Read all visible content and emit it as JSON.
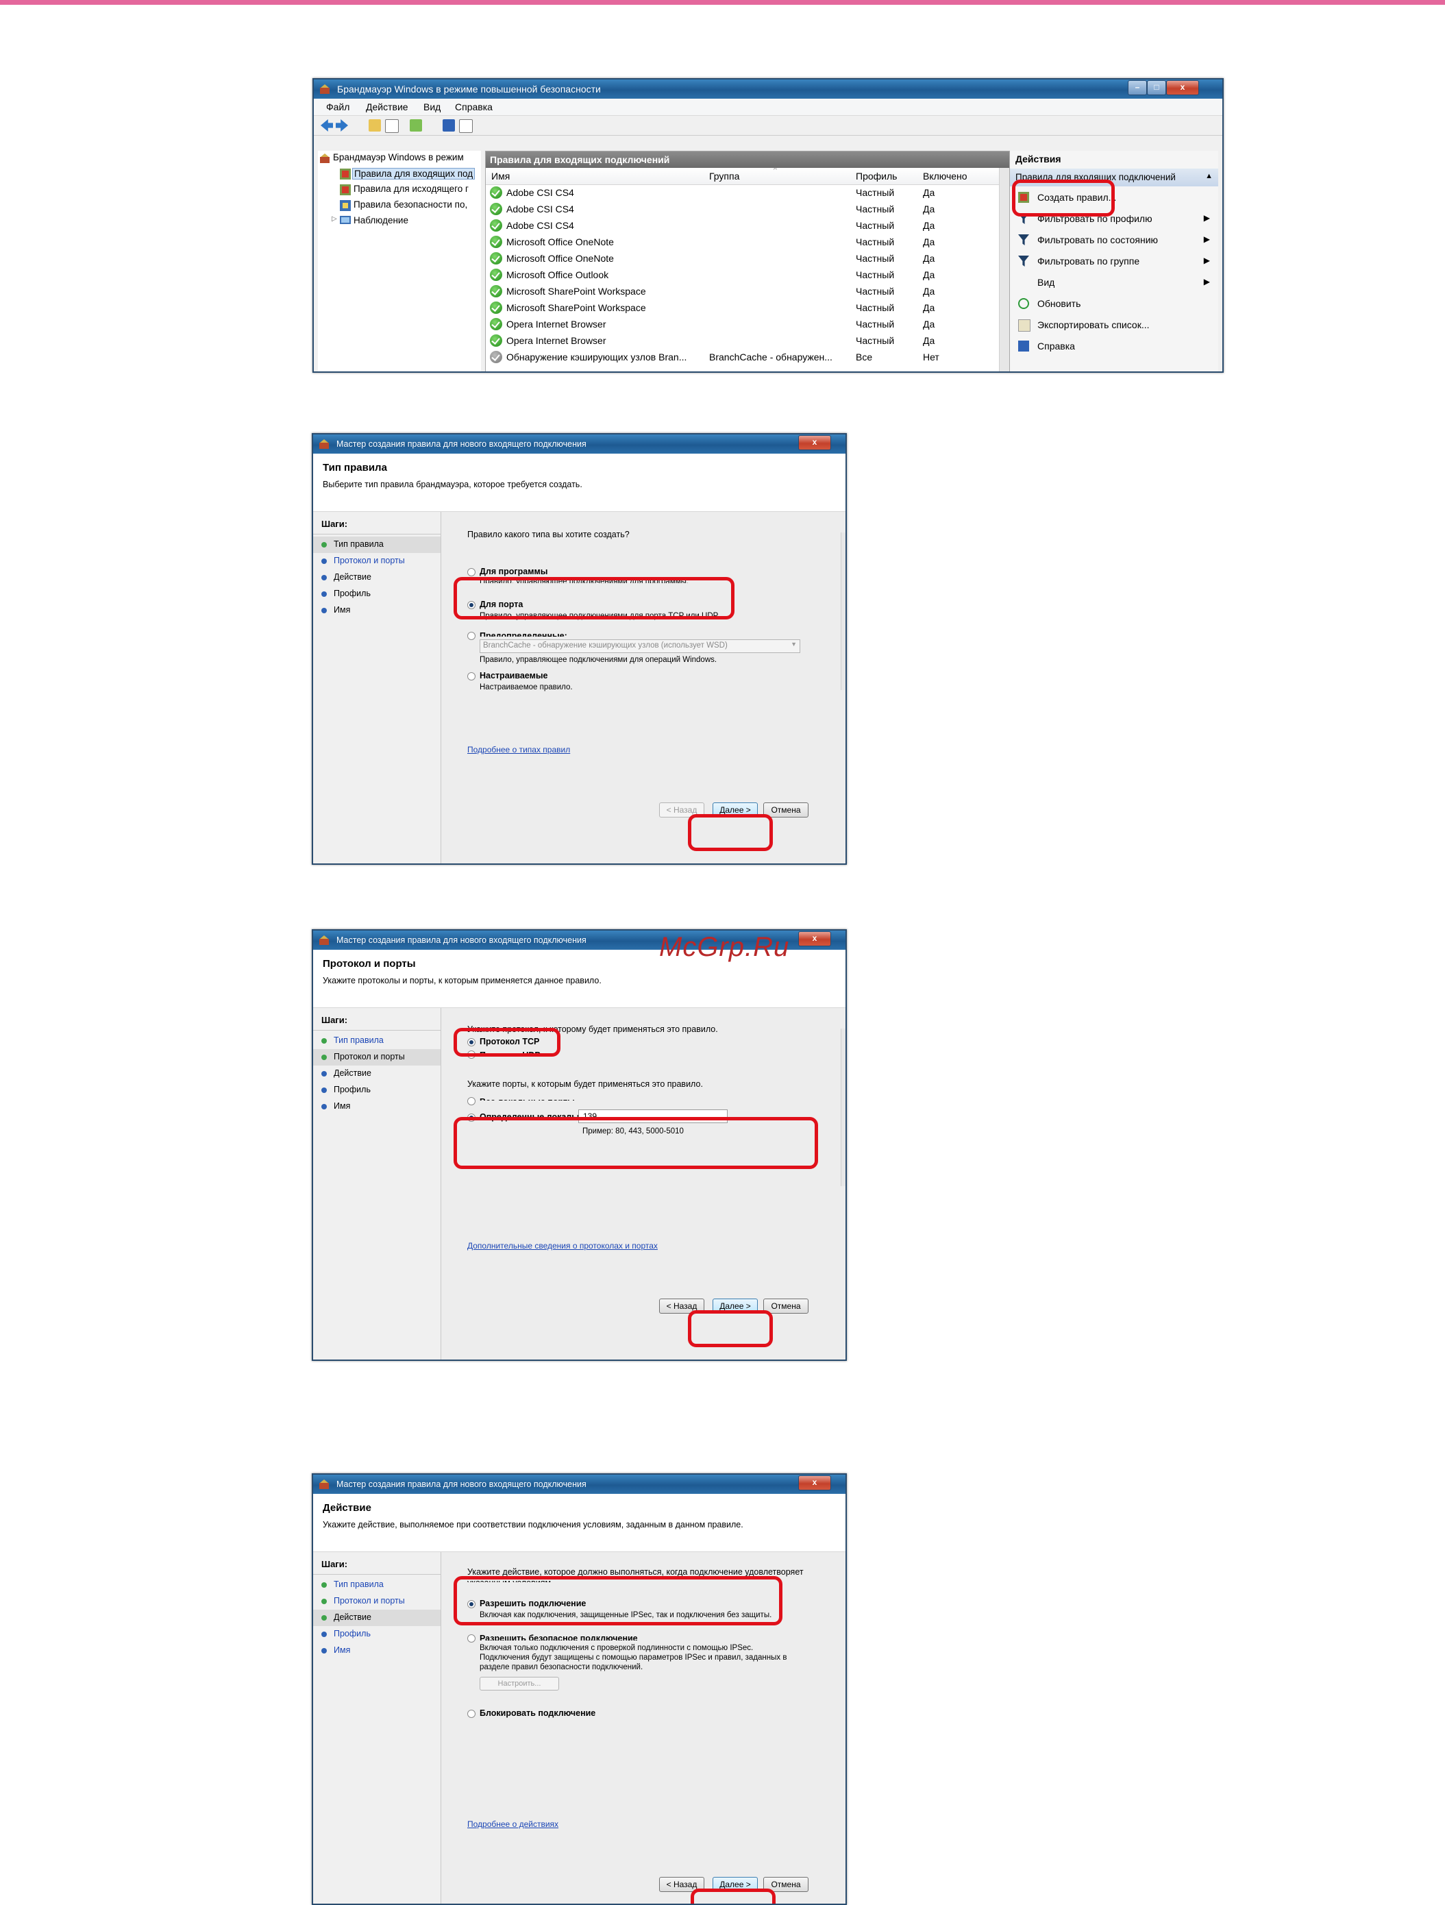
{
  "watermark": "McGrp.Ru",
  "main_window": {
    "title": "Брандмауэр Windows в режиме повышенной безопасности",
    "menu": [
      "Файл",
      "Действие",
      "Вид",
      "Справка"
    ],
    "tree": {
      "root": "Брандмауэр Windows в режим",
      "items": [
        "Правила для входящих под",
        "Правила для исходящего г",
        "Правила безопасности по,",
        "Наблюдение"
      ]
    },
    "rules_pane": {
      "title": "Правила для входящих подключений",
      "columns": [
        "Имя",
        "Группа",
        "Профиль",
        "Включено"
      ],
      "rows": [
        {
          "name": "Adobe CSI CS4",
          "group": "",
          "profile": "Частный",
          "enabled": "Да"
        },
        {
          "name": "Adobe CSI CS4",
          "group": "",
          "profile": "Частный",
          "enabled": "Да"
        },
        {
          "name": "Adobe CSI CS4",
          "group": "",
          "profile": "Частный",
          "enabled": "Да"
        },
        {
          "name": "Microsoft Office OneNote",
          "group": "",
          "profile": "Частный",
          "enabled": "Да"
        },
        {
          "name": "Microsoft Office OneNote",
          "group": "",
          "profile": "Частный",
          "enabled": "Да"
        },
        {
          "name": "Microsoft Office Outlook",
          "group": "",
          "profile": "Частный",
          "enabled": "Да"
        },
        {
          "name": "Microsoft SharePoint Workspace",
          "group": "",
          "profile": "Частный",
          "enabled": "Да"
        },
        {
          "name": "Microsoft SharePoint Workspace",
          "group": "",
          "profile": "Частный",
          "enabled": "Да"
        },
        {
          "name": "Opera Internet Browser",
          "group": "",
          "profile": "Частный",
          "enabled": "Да"
        },
        {
          "name": "Opera Internet Browser",
          "group": "",
          "profile": "Частный",
          "enabled": "Да"
        },
        {
          "name": "Обнаружение кэширующих узлов Bran...",
          "group": "BranchCache - обнаружен...",
          "profile": "Все",
          "enabled": "Нет"
        }
      ]
    },
    "actions_pane": {
      "title": "Действия",
      "section": "Правила для входящих подключений",
      "items": [
        "Создать правил...",
        "Фильтровать по профилю",
        "Фильтровать по состоянию",
        "Фильтровать по группе",
        "Вид",
        "Обновить",
        "Экспортировать список...",
        "Справка"
      ]
    }
  },
  "wizard_common": {
    "title": "Мастер создания правила для нового входящего подключения",
    "steps_header": "Шаги:",
    "steps": [
      "Тип правила",
      "Протокол и порты",
      "Действие",
      "Профиль",
      "Имя"
    ],
    "back": "< Назад",
    "next": "Далее >",
    "cancel": "Отмена"
  },
  "wizard1": {
    "heading": "Тип правила",
    "subheading": "Выберите тип правила брандмауэра, которое требуется создать.",
    "question": "Правило какого типа вы хотите создать?",
    "options": [
      {
        "label": "Для программы",
        "desc": "Правило, управляющее подключениями для программы."
      },
      {
        "label": "Для порта",
        "desc": "Правило, управляющее подключениями для порта TCP или UDP."
      },
      {
        "label": "Предопределенные:",
        "desc": "Правило, управляющее подключениями для операций Windows."
      },
      {
        "label": "Настраиваемые",
        "desc": "Настраиваемое правило."
      }
    ],
    "predefined_select": "BranchCache - обнаружение кэширующих узлов (использует WSD)",
    "link": "Подробнее о типах правил"
  },
  "wizard2": {
    "heading": "Протокол и порты",
    "subheading": "Укажите протоколы и порты, к которым применяется данное правило.",
    "protocol_question": "Укажите протокол, к которому будет применяться это правило.",
    "protocols": [
      "Протокол TCP",
      "Протокол UDP"
    ],
    "ports_question": "Укажите порты, к которым будет применяться это правило.",
    "ports_all": "Все локальные порты",
    "ports_specific": "Определенные локальные порты:",
    "ports_value": "139",
    "ports_example": "Пример: 80, 443, 5000-5010",
    "link": "Дополнительные сведения о протоколах и портах"
  },
  "wizard3": {
    "heading": "Действие",
    "subheading": "Укажите действие, выполняемое при соответствии подключения условиям, заданным в данном правиле.",
    "question_line1": "Укажите действие, которое должно выполняться, когда подключение удовлетворяет",
    "question_line2": "указанным условиям.",
    "options": [
      {
        "label": "Разрешить подключение",
        "desc": [
          "Включая как подключения, защищенные IPSec, так и подключения без защиты."
        ]
      },
      {
        "label": "Разрешить безопасное подключение",
        "desc": [
          "Включая только подключения с проверкой подлинности с помощью IPSec.",
          "Подключения будут защищены с помощью параметров IPSec и правил, заданных в",
          "разделе правил безопасности подключений."
        ]
      },
      {
        "label": "Блокировать подключение",
        "desc": []
      }
    ],
    "configure": "Настроить...",
    "link": "Подробнее о действиях"
  }
}
